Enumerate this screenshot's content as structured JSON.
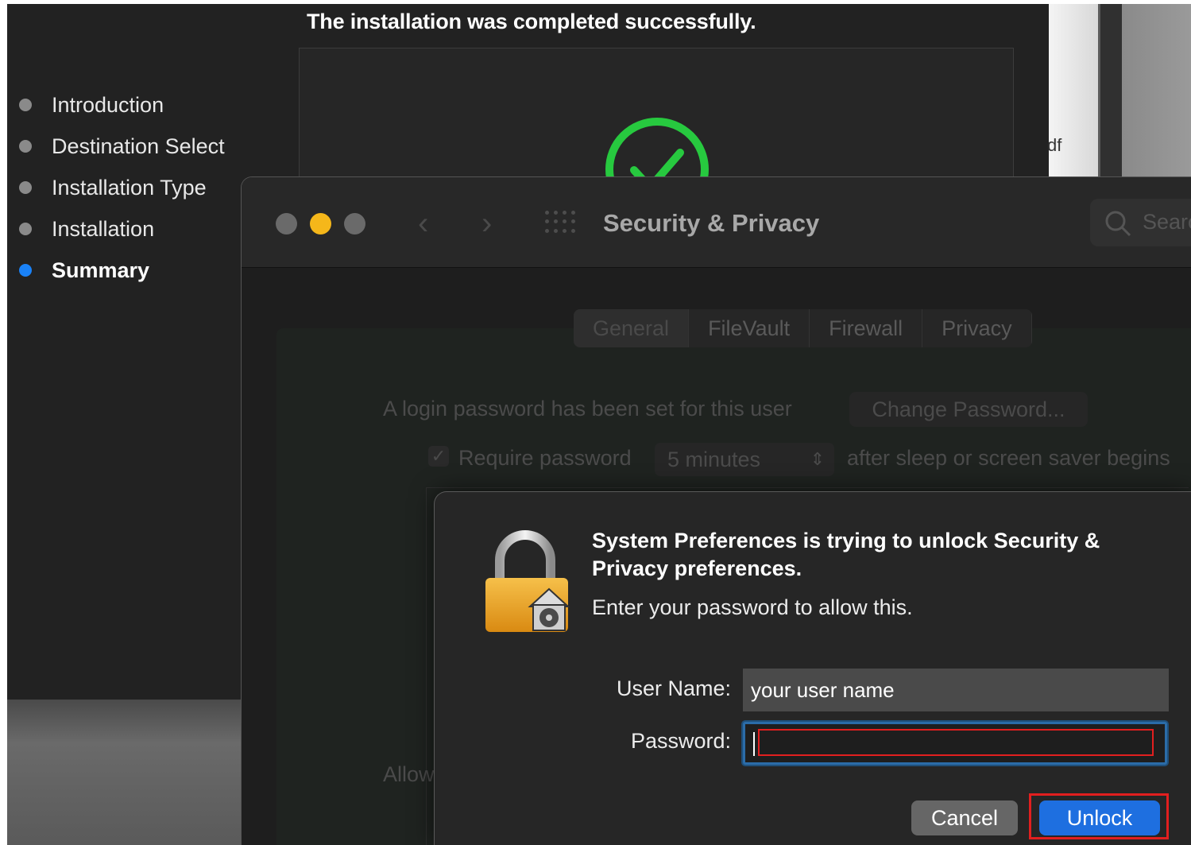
{
  "installer": {
    "status_message": "The installation was completed successfully.",
    "steps": [
      {
        "label": "Introduction",
        "active": false
      },
      {
        "label": "Destination Select",
        "active": false
      },
      {
        "label": "Installation Type",
        "active": false
      },
      {
        "label": "Installation",
        "active": false
      },
      {
        "label": "Summary",
        "active": true
      }
    ],
    "success_color": "#27c93f"
  },
  "background_peek_text": "df",
  "security_window": {
    "title": "Security & Privacy",
    "search_placeholder": "Searc",
    "tabs": [
      "General",
      "FileVault",
      "Firewall",
      "Privacy"
    ],
    "selected_tab": "General",
    "login_password_text": "A login password has been set for this user",
    "change_password_label": "Change Password...",
    "require_password_label": "Require password",
    "require_password_value": "5 minutes",
    "after_sleep_text": "after sleep or screen saver begins",
    "allow_text": "Allow"
  },
  "dialog": {
    "heading": "System Preferences is trying to unlock Security & Privacy preferences.",
    "subtext": "Enter your password to allow this.",
    "username_label": "User Name:",
    "username_value": "your user name",
    "password_label": "Password:",
    "password_value": "",
    "cancel_label": "Cancel",
    "unlock_label": "Unlock"
  },
  "colors": {
    "accent": "#1e6fe0",
    "highlight": "#e21f1f",
    "traffic_min": "#f5b71a"
  }
}
